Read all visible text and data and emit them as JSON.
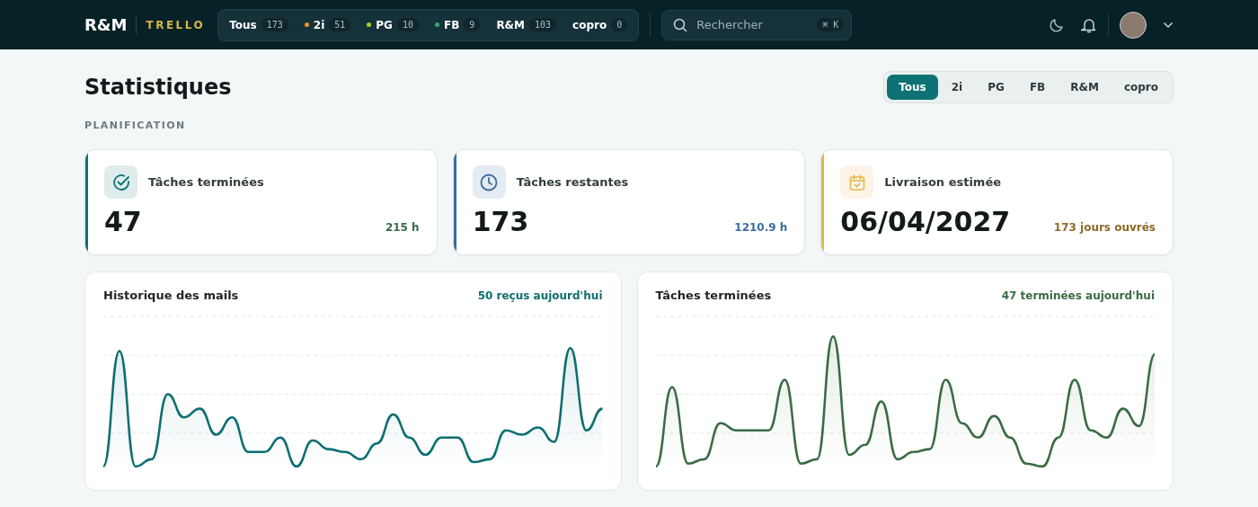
{
  "header": {
    "logo": "R&M",
    "brand": "TRELLO",
    "filters": [
      {
        "label": "Tous",
        "count": "173"
      },
      {
        "label": "2i",
        "count": "51",
        "color": "#f0902c"
      },
      {
        "label": "PG",
        "count": "10",
        "color": "#a6d12e"
      },
      {
        "label": "FB",
        "count": "9",
        "color": "#2fae5b"
      },
      {
        "label": "R&M",
        "count": "103"
      },
      {
        "label": "copro",
        "count": "0"
      }
    ],
    "search": {
      "placeholder": "Rechercher",
      "shortcut": "⌘ K"
    }
  },
  "page": {
    "title": "Statistiques",
    "tabs": [
      {
        "label": "Tous",
        "selected": true
      },
      {
        "label": "2i",
        "selected": false
      },
      {
        "label": "PG",
        "selected": false
      },
      {
        "label": "FB",
        "selected": false
      },
      {
        "label": "R&M",
        "selected": false
      },
      {
        "label": "copro",
        "selected": false
      }
    ],
    "section": "PLANIFICATION",
    "cards": [
      {
        "kind": "done",
        "label": "Tâches terminées",
        "value": "47",
        "note": "215 h",
        "color": "#0e7274"
      },
      {
        "kind": "remaining",
        "label": "Tâches restantes",
        "value": "173",
        "note": "1210.9 h",
        "color": "#3d6c9e"
      },
      {
        "kind": "delivery",
        "label": "Livraison estimée",
        "value": "06/04/2027",
        "note": "173 jours ouvrés",
        "color": "#e6b54a"
      }
    ],
    "charts": [
      {
        "title": "Historique des mails",
        "note": "50 reçus aujourd'hui"
      },
      {
        "title": "Tâches terminées",
        "note": "47 terminées aujourd'hui"
      }
    ]
  }
}
